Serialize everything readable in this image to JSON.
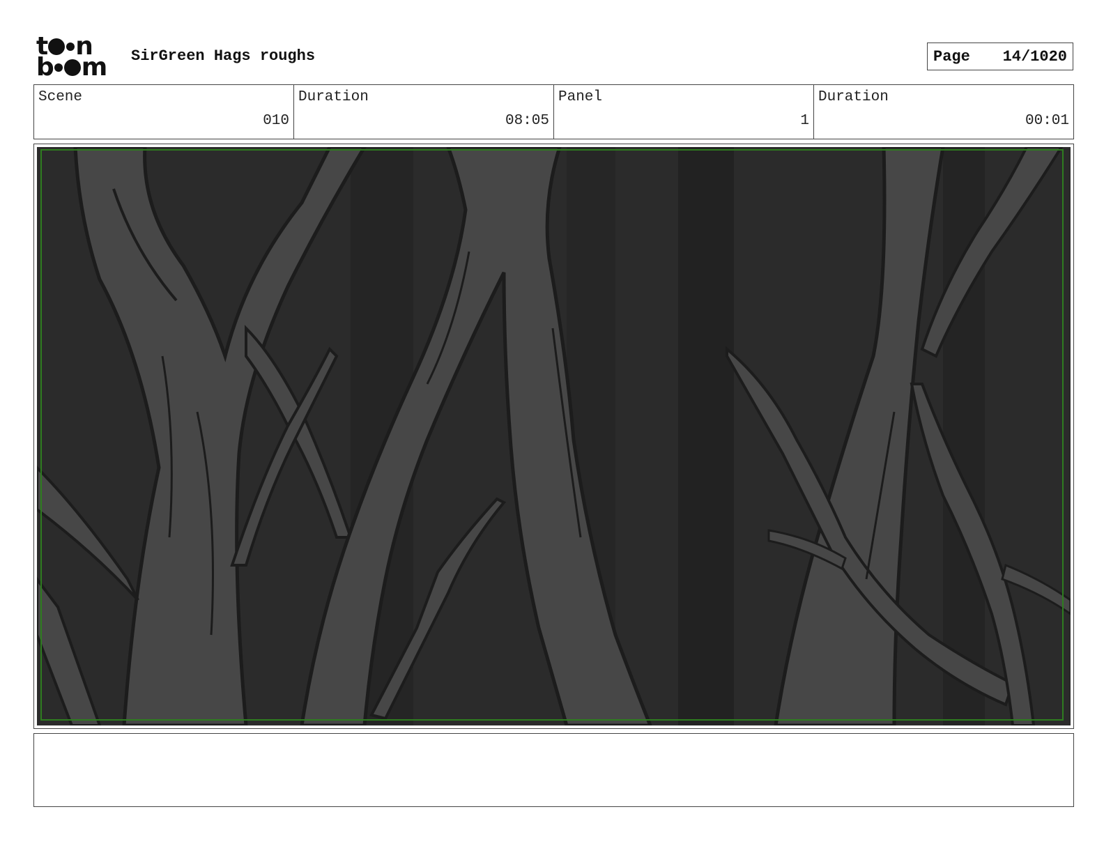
{
  "header": {
    "brand_logo_text": "toon boom",
    "project_title": "SirGreen Hags roughs",
    "page_label": "Page",
    "page_number": "14/1020"
  },
  "info": {
    "scene_label": "Scene",
    "scene_value": "010",
    "scene_duration_label": "Duration",
    "scene_duration_value": "08:05",
    "panel_label": "Panel",
    "panel_value": "1",
    "panel_duration_label": "Duration",
    "panel_duration_value": "00:01"
  },
  "panel": {
    "safe_frame_color": "#2e7d1f",
    "background_color": "#2b2b2b",
    "tree_color": "#474747",
    "outline_color": "#1c1c1c"
  },
  "notes": {
    "text": ""
  }
}
